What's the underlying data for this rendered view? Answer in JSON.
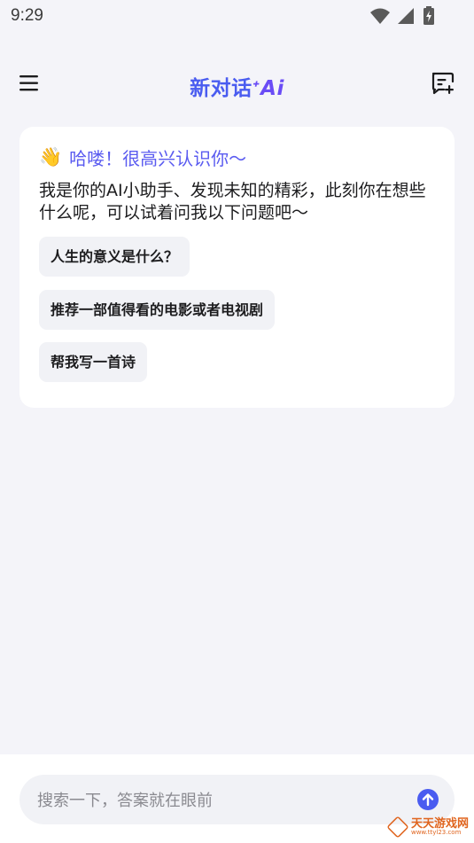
{
  "status_bar": {
    "time": "9:29"
  },
  "header": {
    "title_main": "新对话",
    "title_ai": "ᐩAi"
  },
  "icons": {
    "menu": "hamburger-menu-icon",
    "new_chat": "new-chat-icon",
    "send": "arrow-up-icon",
    "wave": "waving-hand-icon"
  },
  "card": {
    "wave_emoji": "👋",
    "greeting": "哈喽！很高兴认识你～",
    "intro": "我是你的AI小助手、发现未知的精彩，此刻你在想些什么呢，可以试着问我以下问题吧～",
    "suggestions": [
      "人生的意义是什么？",
      "推荐一部值得看的电影或者电视剧",
      "帮我写一首诗"
    ]
  },
  "input": {
    "placeholder": "搜索一下，答案就在眼前",
    "value": ""
  },
  "watermark": {
    "title": "天天游戏网",
    "url": "www.ttyl23.com"
  },
  "colors": {
    "accent": "#4a5cf0",
    "background": "#f4f4f9",
    "card": "#ffffff",
    "chip": "#f1f2f6"
  }
}
